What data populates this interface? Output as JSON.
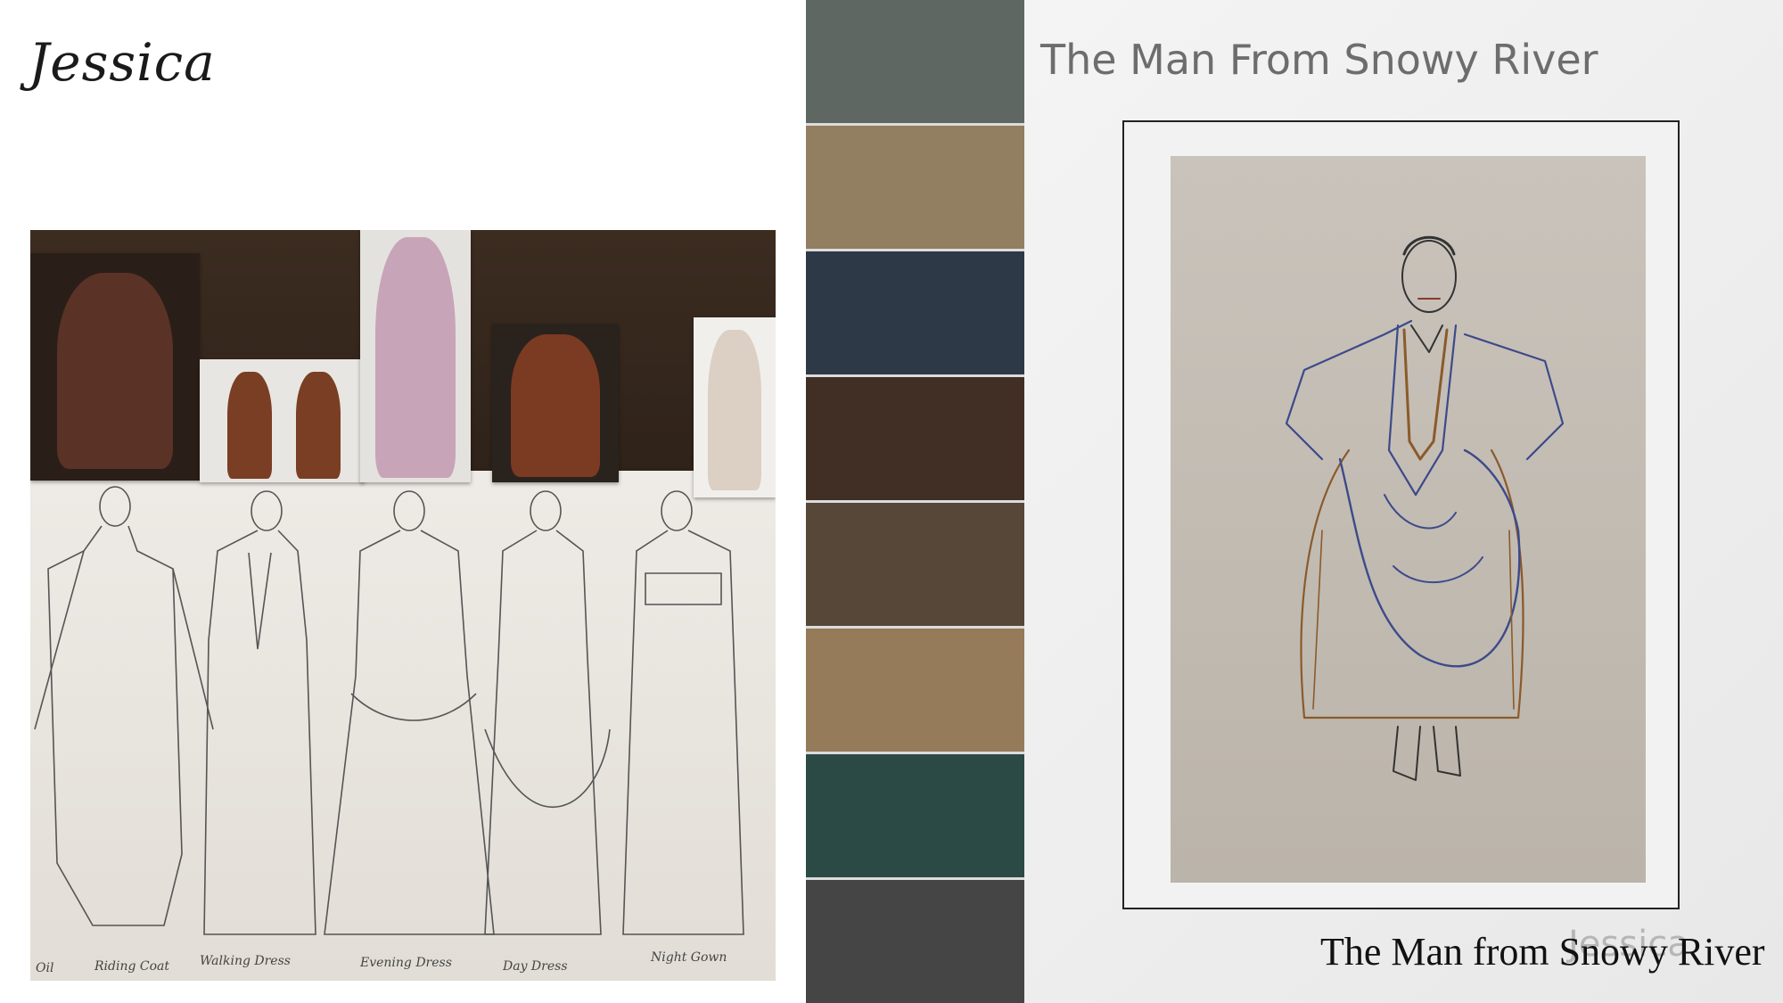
{
  "left": {
    "character_name": "Jessica",
    "sketch_labels": [
      "Oil",
      "Riding Coat",
      "Walking Dress",
      "Evening Dress",
      "Day Dress",
      "Night Gown"
    ]
  },
  "palette": {
    "colors": [
      "#5f6763",
      "#927e60",
      "#2d3947",
      "#412f25",
      "#564738",
      "#957b5a",
      "#2c4a45",
      "#464545"
    ]
  },
  "right": {
    "heading": "The Man From Snowy River",
    "subtitle": "The Man from Snowy River",
    "watermark": "Jessica"
  }
}
